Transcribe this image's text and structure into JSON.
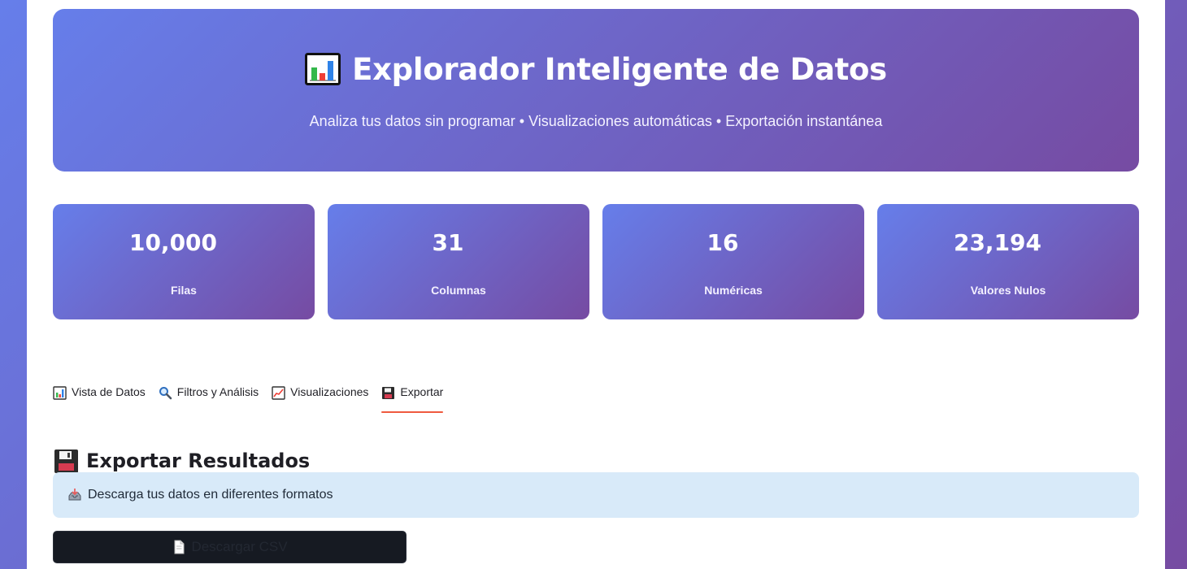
{
  "colors": {
    "page_gradient_start": "#667eea",
    "page_gradient_end": "#764ba2",
    "panel": "#ffffff",
    "info_background": "#d8eaf9",
    "active_tab": "#ef5a3f",
    "download_button": "#161a22"
  },
  "header": {
    "icon": "bar-chart-icon",
    "title": "Explorador Inteligente de Datos",
    "subtitle": "Analiza tus datos sin programar • Visualizaciones automáticas • Exportación instantánea"
  },
  "metrics": [
    {
      "value": "10,000",
      "label": "Filas"
    },
    {
      "value": "31",
      "label": "Columnas"
    },
    {
      "value": "16",
      "label": "Numéricas"
    },
    {
      "value": "23,194",
      "label": "Valores Nulos"
    }
  ],
  "tabs": [
    {
      "icon": "bar-chart-icon",
      "label": "Vista de Datos",
      "active": false
    },
    {
      "icon": "magnifying-glass-icon",
      "label": "Filtros y Análisis",
      "active": false
    },
    {
      "icon": "line-chart-icon",
      "label": "Visualizaciones",
      "active": false
    },
    {
      "icon": "floppy-disk-icon",
      "label": "Exportar",
      "active": true
    }
  ],
  "export": {
    "icon": "floppy-disk-icon",
    "title": "Exportar Resultados",
    "info_icon": "inbox-tray-icon",
    "info_text": "Descarga tus datos en diferentes formatos",
    "download_icon": "document-icon",
    "download_label": "Descargar CSV"
  }
}
